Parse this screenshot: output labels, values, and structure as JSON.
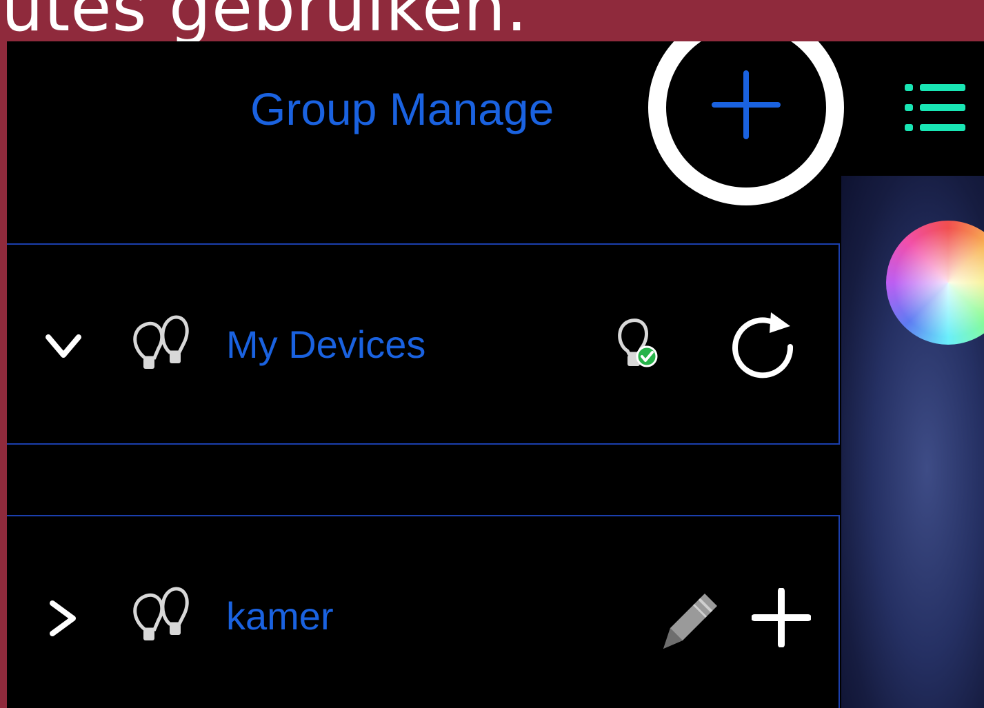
{
  "banner": {
    "text": "dutes gebruiken."
  },
  "header": {
    "title": "Group Manage"
  },
  "icons": {
    "add_group": "plus-icon",
    "menu": "list-menu-icon",
    "color_wheel": "color-wheel-icon"
  },
  "groups": [
    {
      "label": "My Devices",
      "expanded": true,
      "icons": [
        "chevron-down-icon",
        "bulbs-icon",
        "bulb-status-icon",
        "refresh-icon"
      ]
    },
    {
      "label": "kamer",
      "expanded": false,
      "icons": [
        "chevron-right-icon",
        "bulbs-icon",
        "pencil-icon",
        "plus-icon"
      ]
    }
  ],
  "colors": {
    "banner": "#8f2a3c",
    "title_blue": "#1a62e0",
    "row_border": "#1b3fae",
    "menu_green": "#19e6b4",
    "status_green": "#27b34a",
    "highlight_ring": "#ffffff"
  }
}
